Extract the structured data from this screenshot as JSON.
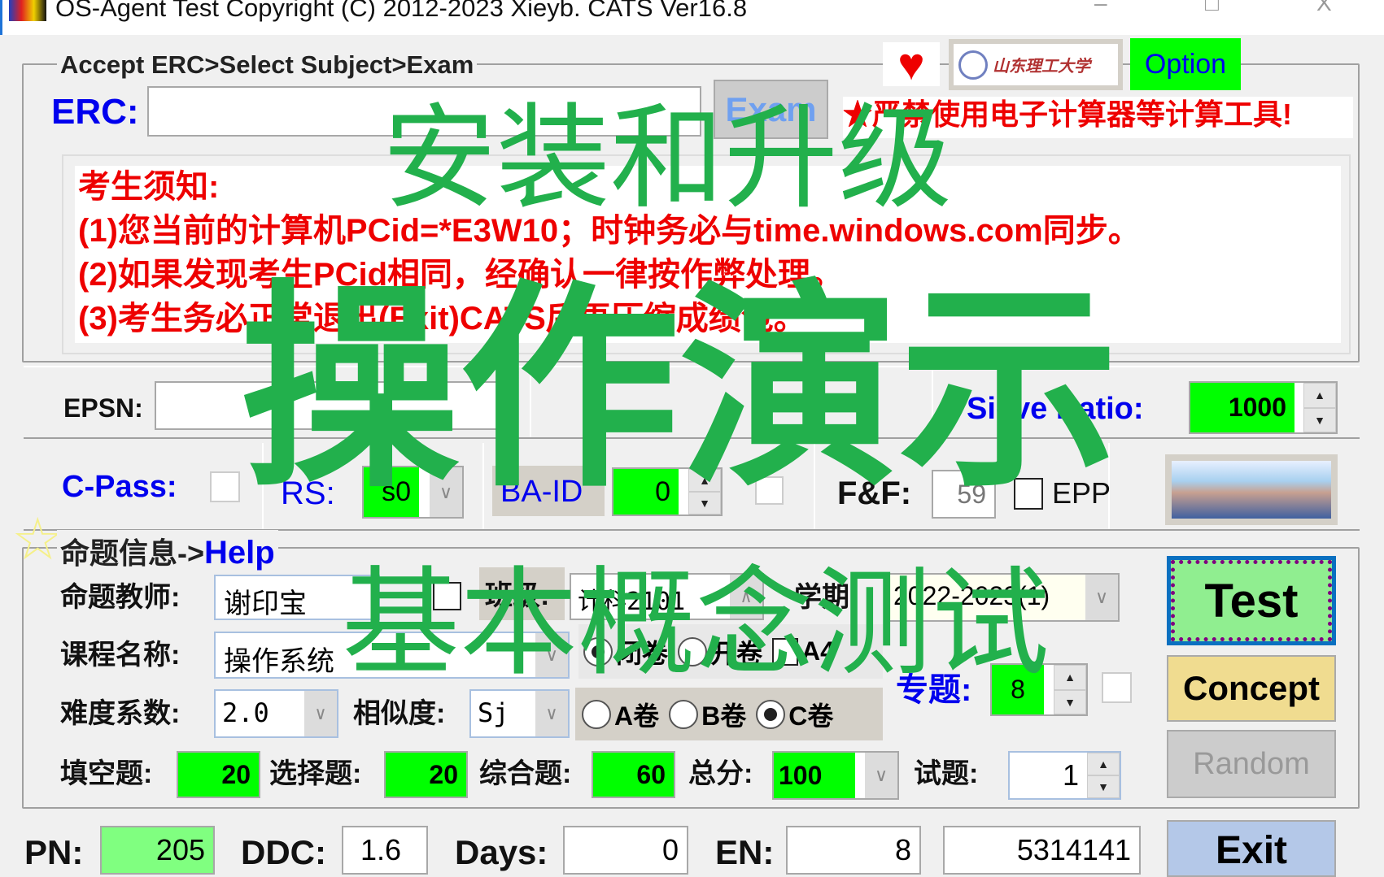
{
  "window": {
    "title": "OS-Agent Test Copyright (C) 2012-2023 Xieyb. CATS Ver16.8",
    "minimize": "–",
    "maximize": "□",
    "close": "X"
  },
  "header": {
    "legend": "Accept ERC>Select Subject>Exam",
    "erc_label": "ERC:",
    "erc_value": "",
    "exam_button": "Exam",
    "option_button": "Option",
    "warning": "★严禁使用电子计算器等计算工具!",
    "logo_text": "山东理工大学"
  },
  "notice": {
    "heading": "考生须知:",
    "lines": [
      "(1)您当前的计算机PCid=*E3W10；时钟务必与time.windows.com同步。",
      "(2)如果发现考生PCid相同，经确认一律按作弊处理。",
      "(3)考生务必正常退出(Exit)CATS后再压缩成绩包。"
    ]
  },
  "epsn": {
    "label": "EPSN:",
    "value": "",
    "sieve_label": "Sieve Ratio:",
    "sieve_value": "1000"
  },
  "row2": {
    "cpass_label": "C-Pass:",
    "rs_label": "RS:",
    "rs_value": "s0",
    "baid_label": "BA-ID",
    "baid_value": "0",
    "ff_label": "F&F:",
    "ff_value": "59",
    "epp_label": "EPP"
  },
  "info": {
    "legend": "命题信息->",
    "help": "Help",
    "teacher_label": "命题教师:",
    "teacher_value": "谢印宝",
    "class_label": "班级:",
    "class_value": "计科2101",
    "term_label": "学期:",
    "term_value": "2022-2023(1)",
    "course_label": "课程名称:",
    "course_value": "操作系统",
    "closed_label": "闭卷",
    "open_label": "开卷",
    "a4_label": "A4",
    "topic_label": "专题:",
    "topic_value": "8",
    "difficulty_label": "难度系数:",
    "difficulty_value": "2.0",
    "similarity_label": "相似度:",
    "similarity_value": "Sj",
    "paper_a": "A卷",
    "paper_b": "B卷",
    "paper_c": "C卷",
    "paper_selected": "C卷",
    "fill_label": "填空题:",
    "fill_value": "20",
    "choice_label": "选择题:",
    "choice_value": "20",
    "comp_label": "综合题:",
    "comp_value": "60",
    "total_label": "总分:",
    "total_value": "100",
    "test_label": "试题:",
    "test_value": "1"
  },
  "buttons": {
    "test": "Test",
    "concept": "Concept",
    "random": "Random",
    "exit": "Exit"
  },
  "status": {
    "pn_label": "PN:",
    "pn_value": "205",
    "ddc_label": "DDC:",
    "ddc_value": "1.6",
    "days_label": "Days:",
    "days_value": "0",
    "en_label": "EN:",
    "en_value": "8",
    "code_value": "5314141"
  },
  "overlay": {
    "line1": "安装和升级",
    "line2": "操作演示",
    "line3": "基本概念测试"
  },
  "colors": {
    "overlay": "#22b04c",
    "notice": "#ee0000",
    "accent_green": "#00ff00",
    "label_blue": "#0000ee"
  }
}
